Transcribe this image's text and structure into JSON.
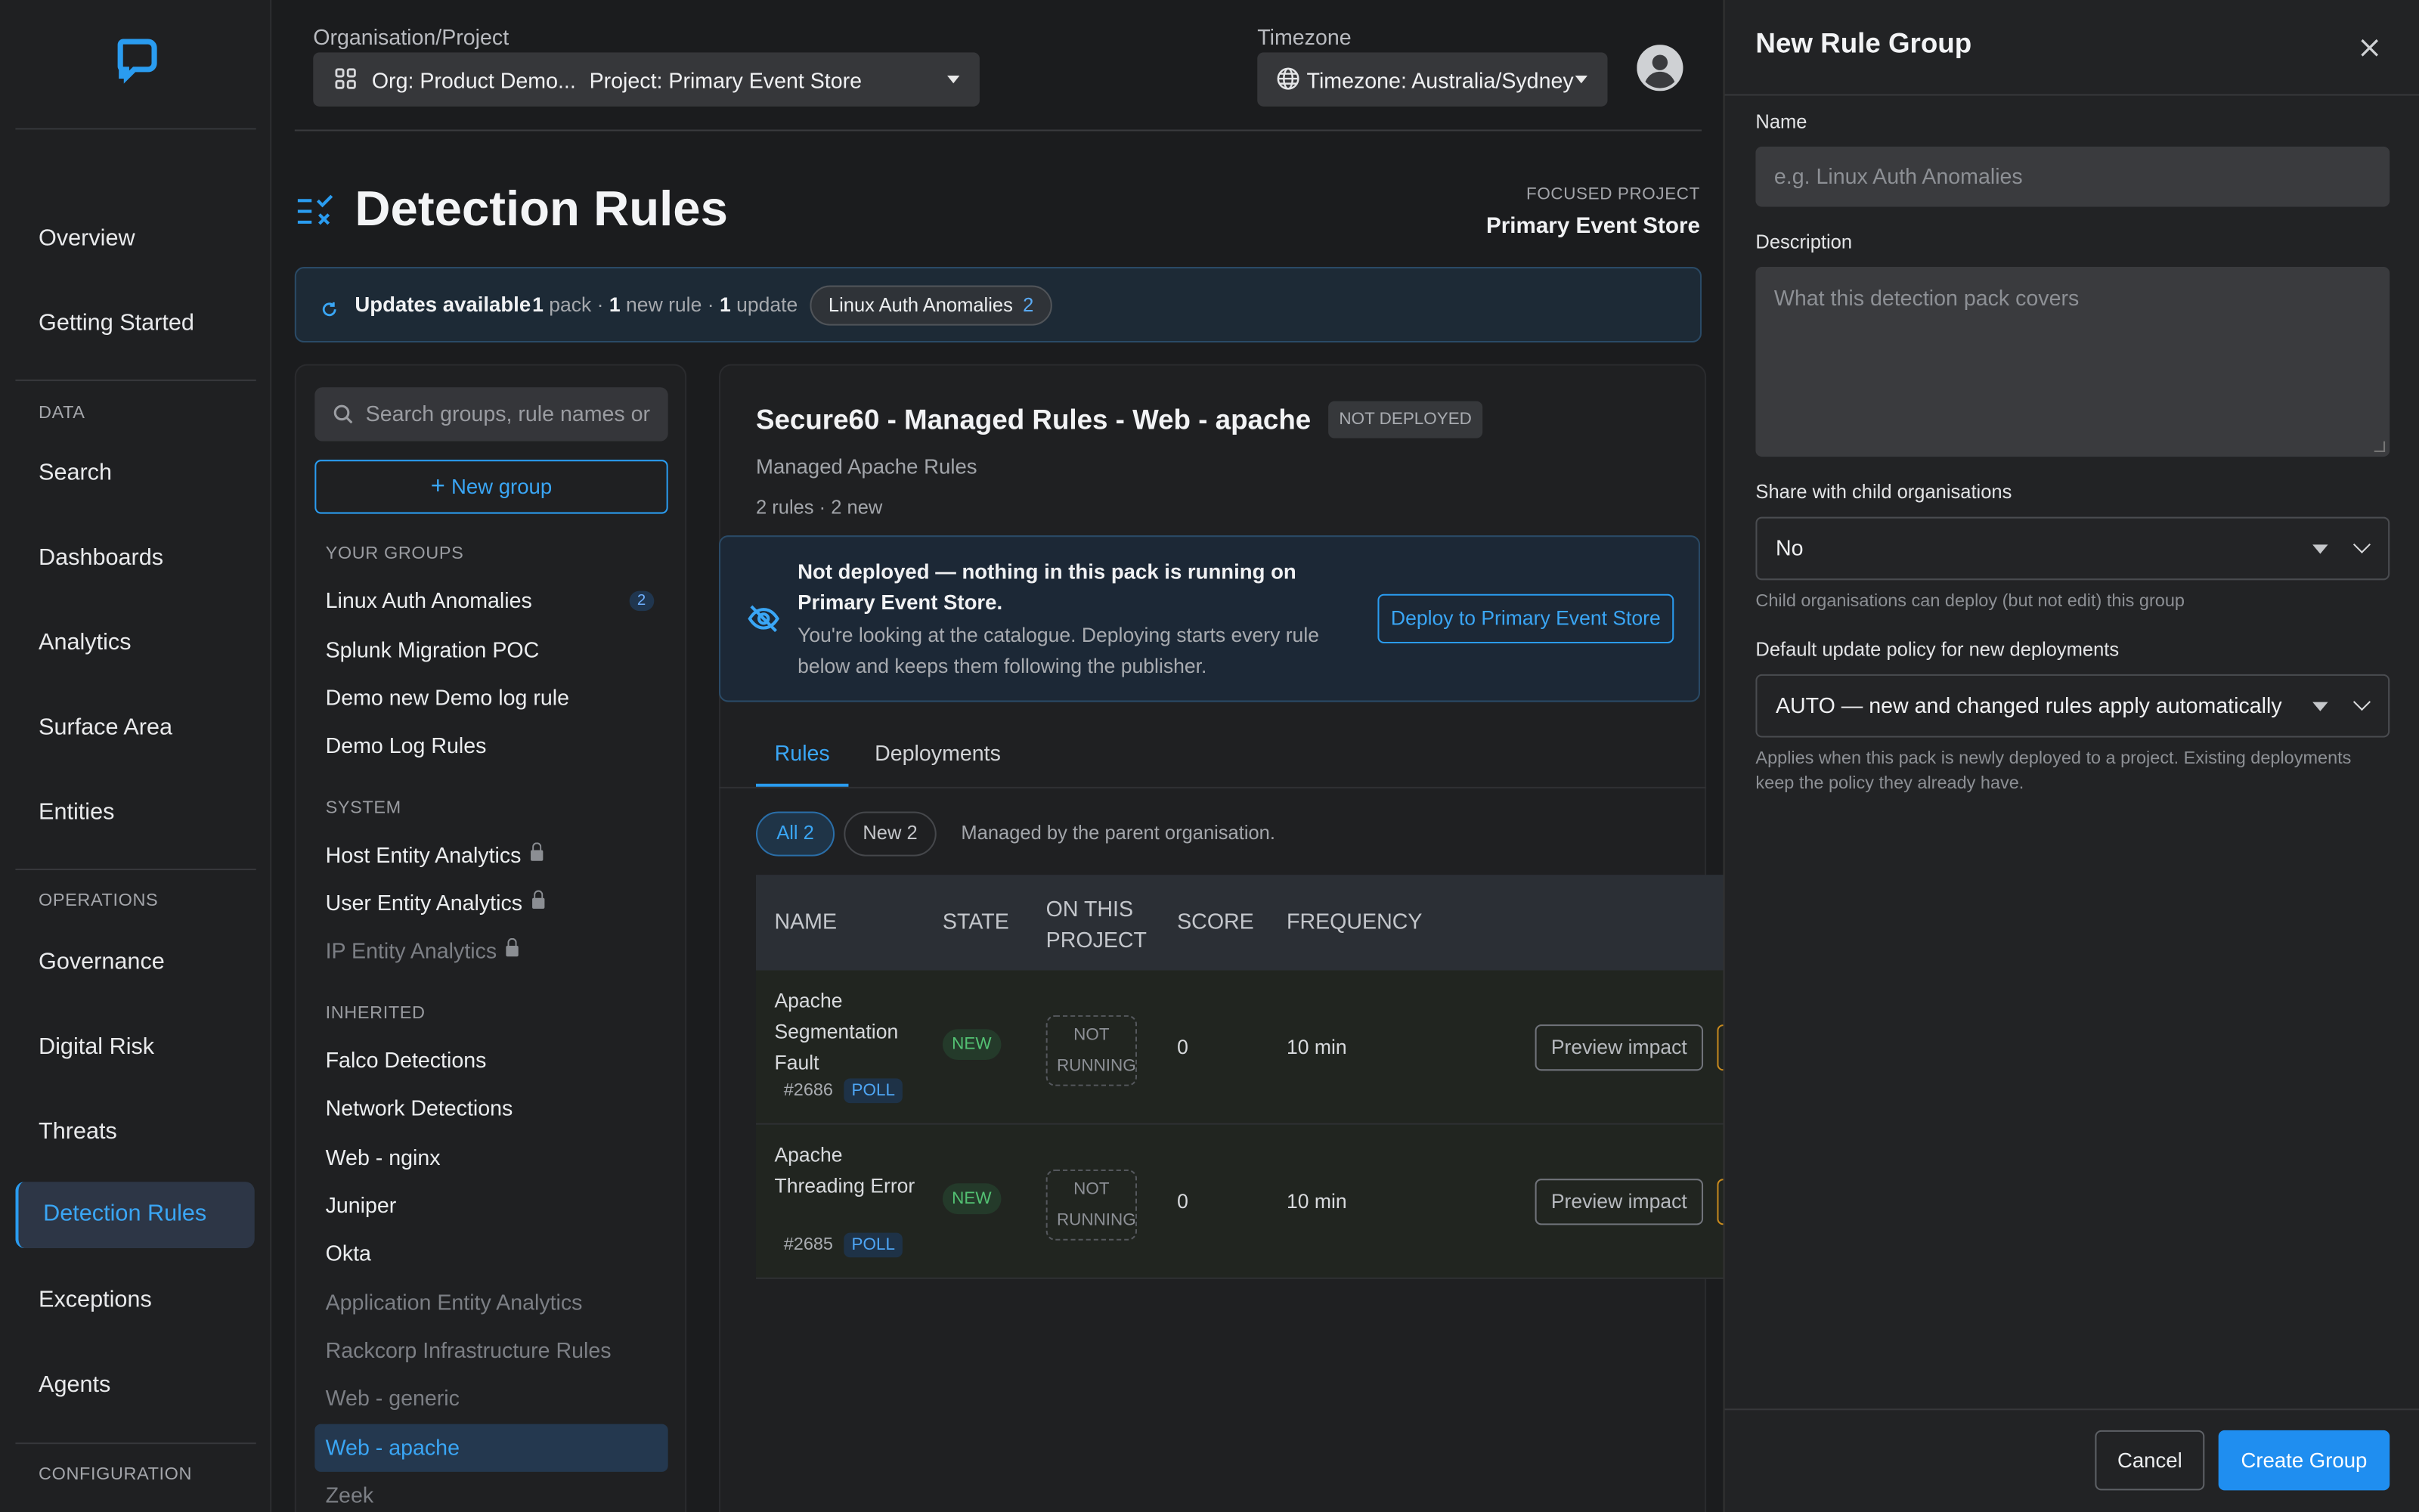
{
  "nav": {
    "items": [
      "Overview",
      "Getting Started"
    ],
    "data_section": "DATA",
    "data_items": [
      "Search",
      "Dashboards",
      "Analytics",
      "Surface Area",
      "Entities"
    ],
    "ops_section": "OPERATIONS",
    "ops_items": [
      "Governance",
      "Digital Risk",
      "Threats",
      "Detection Rules",
      "Exceptions",
      "Agents"
    ],
    "config_section": "CONFIGURATION",
    "active": "Detection Rules"
  },
  "header": {
    "org_label": "Organisation/Project",
    "org_value": "Org: Product Demo...",
    "project_value": "Project: Primary Event Store",
    "tz_label": "Timezone",
    "tz_value": "Timezone: Australia/Sydney"
  },
  "page": {
    "title": "Detection Rules",
    "focused_label": "FOCUSED PROJECT",
    "focused_value": "Primary Event Store"
  },
  "updates": {
    "label": "Updates available",
    "n_pack": "1",
    "pack": "pack ·",
    "n_rule": "1",
    "rule": "new rule ·",
    "n_update": "1",
    "update": "update",
    "chip_label": "Linux Auth Anomalies",
    "chip_count": "2"
  },
  "groups": {
    "search_placeholder": "Search groups, rule names or r",
    "new_group": "New group",
    "your_section": "YOUR GROUPS",
    "your": [
      {
        "name": "Linux Auth Anomalies",
        "count": "2"
      },
      {
        "name": "Splunk Migration POC"
      },
      {
        "name": "Demo new Demo log rule"
      },
      {
        "name": "Demo Log Rules"
      }
    ],
    "system_section": "SYSTEM",
    "system": [
      "Host Entity Analytics",
      "User Entity Analytics",
      "IP Entity Analytics"
    ],
    "inherited_section": "INHERITED",
    "inherited": [
      "Falco Detections",
      "Network Detections",
      "Web - nginx",
      "Juniper",
      "Okta",
      "Application Entity Analytics",
      "Rackcorp Infrastructure Rules",
      "Web - generic",
      "Web - apache",
      "Zeek"
    ]
  },
  "detail": {
    "title": "Secure60 - Managed Rules - Web - apache",
    "status": "NOT DEPLOYED",
    "subtitle": "Managed Apache Rules",
    "meta": "2 rules · 2 new",
    "banner_title": "Not deployed — nothing in this pack is running on Primary Event Store.",
    "banner_body": "You're looking at the catalogue. Deploying starts every rule below and keeps them following the publisher.",
    "deploy_button": "Deploy to Primary Event Store",
    "tabs": [
      "Rules",
      "Deployments"
    ],
    "filter_all": "All 2",
    "filter_new": "New 2",
    "filter_note": "Managed by the parent organisation.",
    "columns": [
      "NAME",
      "STATE",
      "ON THIS PROJECT",
      "SCORE",
      "FREQUENCY"
    ],
    "rows": [
      {
        "name": "Apache Segmentation Fault",
        "id": "#2686",
        "type": "POLL",
        "state": "NEW",
        "project": "NOT RUNNING",
        "score": "0",
        "frequency": "10 min",
        "action": "Preview impact"
      },
      {
        "name": "Apache Threading Error",
        "id": "#2685",
        "type": "POLL",
        "state": "NEW",
        "project": "NOT RUNNING",
        "score": "0",
        "frequency": "10 min",
        "action": "Preview impact"
      }
    ]
  },
  "drawer": {
    "title": "New Rule Group",
    "name_label": "Name",
    "name_placeholder": "e.g. Linux Auth Anomalies",
    "desc_label": "Description",
    "desc_placeholder": "What this detection pack covers",
    "share_label": "Share with child organisations",
    "share_value": "No",
    "share_help": "Child organisations can deploy (but not edit) this group",
    "policy_label": "Default update policy for new deployments",
    "policy_value": "AUTO — new and changed rules apply automatically",
    "policy_help": "Applies when this pack is newly deployed to a project. Existing deployments keep the policy they already have.",
    "cancel": "Cancel",
    "create": "Create Group"
  }
}
